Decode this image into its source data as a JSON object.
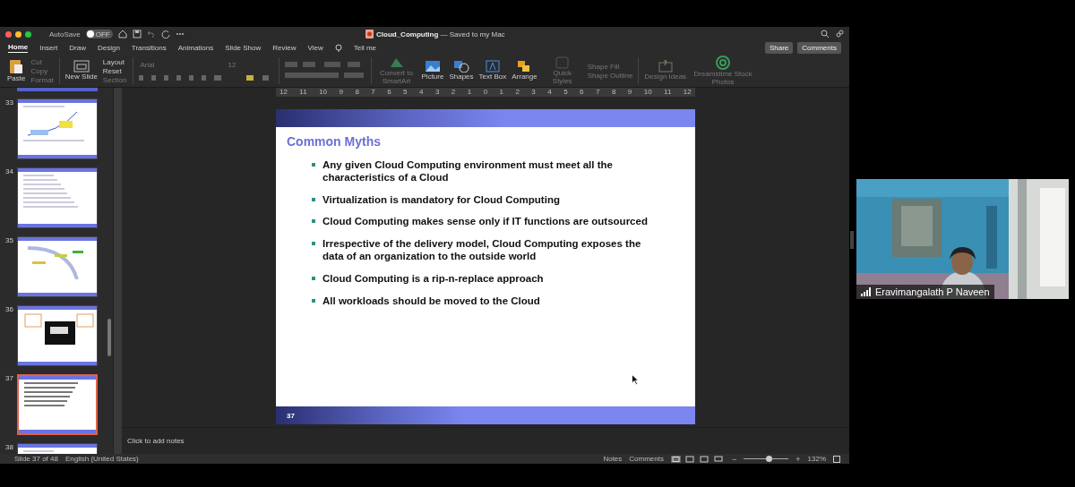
{
  "window": {
    "autosave_label": "AutoSave",
    "autosave_on": false,
    "autosave_state": "OFF",
    "title": "Cloud_Computing",
    "title_suffix": "— Saved to my Mac"
  },
  "tabs": [
    {
      "label": "Home",
      "selected": true
    },
    {
      "label": "Insert",
      "selected": false
    },
    {
      "label": "Draw",
      "selected": false
    },
    {
      "label": "Design",
      "selected": false
    },
    {
      "label": "Transitions",
      "selected": false
    },
    {
      "label": "Animations",
      "selected": false
    },
    {
      "label": "Slide Show",
      "selected": false
    },
    {
      "label": "Review",
      "selected": false
    },
    {
      "label": "View",
      "selected": false
    }
  ],
  "tell_me": "Tell me",
  "share": "Share",
  "comments": "Comments",
  "ribbon": {
    "paste": "Paste",
    "clipboard": [
      {
        "label": "Cut",
        "disabled": true
      },
      {
        "label": "Copy",
        "disabled": true
      },
      {
        "label": "Format",
        "disabled": true
      }
    ],
    "new_slide": "New Slide",
    "slide_tools": [
      {
        "label": "Layout",
        "disabled": false
      },
      {
        "label": "Reset",
        "disabled": false
      },
      {
        "label": "Section",
        "disabled": true
      }
    ],
    "font": "Arial",
    "font_size": "12",
    "large_buttons": [
      {
        "kind": "smartart",
        "label": "Convert to SmartArt",
        "disabled": true
      },
      {
        "kind": "picture",
        "label": "Picture",
        "disabled": false
      },
      {
        "kind": "shapes",
        "label": "Shapes",
        "disabled": false
      },
      {
        "kind": "textbox",
        "label": "Text Box",
        "disabled": false
      },
      {
        "kind": "arrange",
        "label": "Arrange",
        "disabled": false
      },
      {
        "kind": "styles",
        "label": "Quick Styles",
        "disabled": true
      }
    ],
    "shape_fill": "Shape Fill",
    "shape_outline": "Shape Outline",
    "extra_buttons": [
      {
        "kind": "design",
        "label": "Design Ideas",
        "disabled": true
      },
      {
        "kind": "stock",
        "label": "Dreamstime Stock Photos",
        "disabled": true
      }
    ]
  },
  "ruler_labels": [
    "12",
    "11",
    "10",
    "9",
    "8",
    "7",
    "6",
    "5",
    "4",
    "3",
    "2",
    "1",
    "0",
    "1",
    "2",
    "3",
    "4",
    "5",
    "6",
    "7",
    "8",
    "9",
    "10",
    "11",
    "12"
  ],
  "thumbnails": [
    {
      "number": "33",
      "selected": false,
      "kind": "chart"
    },
    {
      "number": "34",
      "selected": false,
      "kind": "list"
    },
    {
      "number": "35",
      "selected": false,
      "kind": "diagram"
    },
    {
      "number": "36",
      "selected": false
    },
    {
      "number": "37",
      "selected": true,
      "kind": "bullets"
    },
    {
      "number": "38",
      "selected": false,
      "kind": "list"
    }
  ],
  "slide": {
    "title": "Common Myths",
    "bullets": [
      "Any given Cloud Computing environment must meet all the characteristics of a Cloud",
      "Virtualization is mandatory for Cloud Computing",
      "Cloud Computing makes sense only if IT functions are outsourced",
      "Irrespective of the delivery model, Cloud Computing exposes the data of an organization to the outside world",
      "Cloud Computing is a rip-n-replace approach",
      "All workloads should be moved to the Cloud"
    ],
    "page_number": "37"
  },
  "notes_placeholder": "Click to add notes",
  "status_bar": {
    "slide_info": "Slide 37 of 48",
    "language": "English (United States)",
    "notes": "Notes",
    "comments": "Comments",
    "zoom_out": "−",
    "zoom_slider": {
      "level": 0.55
    },
    "zoom_in": "+",
    "zoom": "132%"
  },
  "video": {
    "name": "Eravimangalath P Naveen"
  }
}
